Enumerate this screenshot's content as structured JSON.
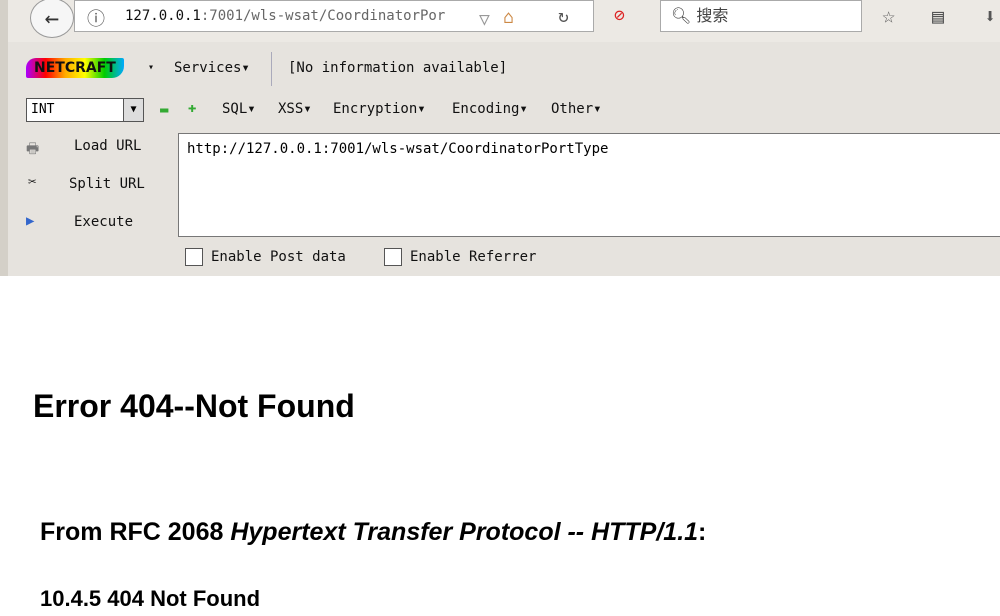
{
  "browser": {
    "url_host": "127.0.0.1",
    "url_rest": ":7001/wls-wsat/CoordinatorPor",
    "search_placeholder": "搜索"
  },
  "hackbar": {
    "logo": "NETCRAFT",
    "services": "Services▾",
    "info": "[No information available]",
    "select_value": "INT",
    "menus": [
      "SQL▾",
      "XSS▾",
      "Encryption▾",
      "Encoding▾",
      "Other▾"
    ],
    "load_url": "Load URL",
    "split_url": "Split URL",
    "execute": "Execute",
    "url_value": "http://127.0.0.1:7001/wls-wsat/CoordinatorPortType",
    "enable_post": "Enable Post data",
    "enable_referrer": "Enable Referrer"
  },
  "page": {
    "title": "Error 404--Not Found",
    "subtitle_prefix": "From RFC 2068 ",
    "subtitle_italic": "Hypertext Transfer Protocol -- HTTP/1.1",
    "subtitle_suffix": ":",
    "section": "10.4.5 404 Not Found"
  }
}
